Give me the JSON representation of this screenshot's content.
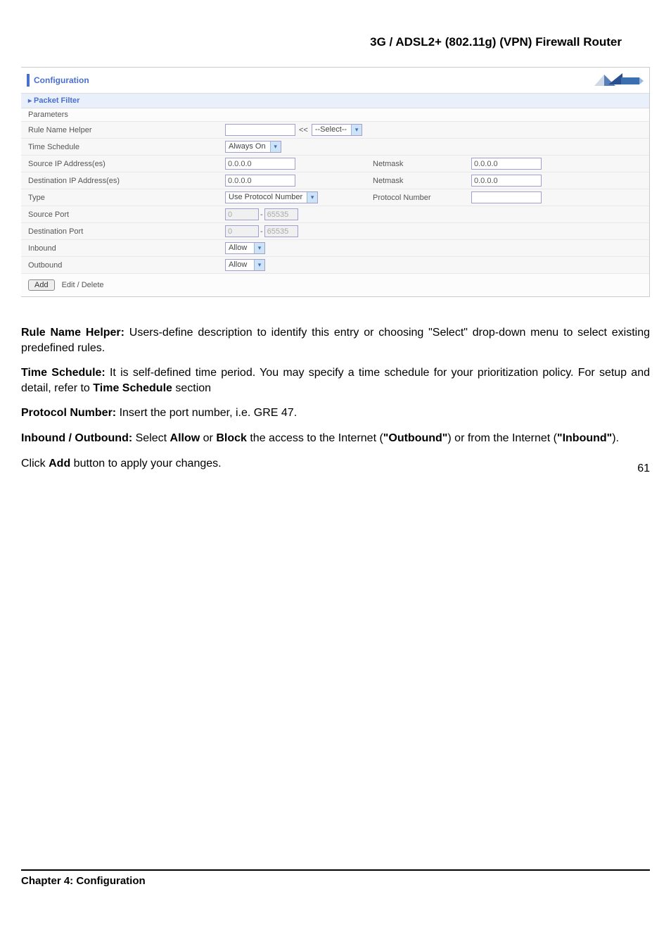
{
  "doc": {
    "title": "3G / ADSL2+ (802.11g) (VPN) Firewall Router",
    "chapter": "Chapter 4: Configuration",
    "page": "61"
  },
  "panel": {
    "title": "Configuration",
    "section": "Packet Filter",
    "parameters_label": "Parameters",
    "rows": {
      "rule_name": {
        "label": "Rule Name Helper",
        "value": "",
        "dd_prefix": "<<",
        "dd_value": "--Select--"
      },
      "time_schedule": {
        "label": "Time Schedule",
        "value": "Always On"
      },
      "src_ip": {
        "label": "Source IP Address(es)",
        "value": "0.0.0.0",
        "mask_label": "Netmask",
        "mask_value": "0.0.0.0"
      },
      "dst_ip": {
        "label": "Destination IP Address(es)",
        "value": "0.0.0.0",
        "mask_label": "Netmask",
        "mask_value": "0.0.0.0"
      },
      "type": {
        "label": "Type",
        "value": "Use Protocol Number",
        "pn_label": "Protocol Number",
        "pn_value": ""
      },
      "src_port": {
        "label": "Source Port",
        "from": "0",
        "to": "65535",
        "dash": "-"
      },
      "dst_port": {
        "label": "Destination Port",
        "from": "0",
        "to": "65535",
        "dash": "-"
      },
      "inbound": {
        "label": "Inbound",
        "value": "Allow"
      },
      "outbound": {
        "label": "Outbound",
        "value": "Allow"
      }
    },
    "buttons": {
      "add": "Add",
      "edit": "Edit / Delete"
    }
  },
  "text": {
    "p1a": "Rule Name Helper:",
    "p1b": " Users-define description to identify this entry or choosing \"Select\" drop-down menu to select existing predefined rules.",
    "p2a": "Time Schedule:",
    "p2b": " It is self-defined time period.   You may specify a time schedule for your prioritization policy. For setup and detail, refer to ",
    "p2c": "Time Schedule",
    "p2d": " section",
    "p3a": "Protocol Number:",
    "p3b": " Insert the port number, i.e. GRE 47.",
    "p4a": "Inbound / Outbound:",
    "p4b": " Select ",
    "p4c": "Allow",
    "p4d": " or ",
    "p4e": "Block",
    "p4f": " the access to the Internet (",
    "p4g": "\"Outbound\"",
    "p4h": ") or from the Internet (",
    "p4i": "\"Inbound\"",
    "p4j": ").",
    "p5a": "Click ",
    "p5b": "Add",
    "p5c": " button to apply your changes."
  }
}
